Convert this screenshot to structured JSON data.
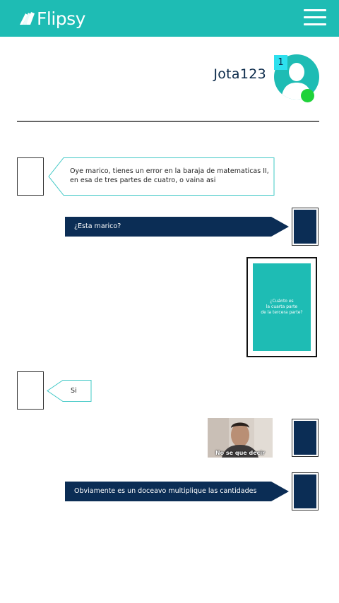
{
  "app": {
    "brand": "Flipsy",
    "colors": {
      "brand_teal": "#1ebcb4",
      "navy": "#0b2d55",
      "online_green": "#1fd23a",
      "badge_cyan": "#2ee0ee"
    },
    "menu_icon": "hamburger-menu-icon"
  },
  "profile": {
    "username": "Jota123",
    "badge_count": "1",
    "avatar_icon": "user-avatar-icon",
    "status": "online"
  },
  "messages": [
    {
      "from": "other",
      "type": "text",
      "text": "Oye marico, tienes un error en la baraja de matematicas II,\nen esa de tres partes de cuatro, o vaina asi"
    },
    {
      "from": "me",
      "type": "text",
      "text": "¿Esta marico?"
    },
    {
      "from": "me",
      "type": "card",
      "text": "¿Cuánto es\nla cuarta parte\nde la tercera parte?"
    },
    {
      "from": "other",
      "type": "text",
      "text": "Si"
    },
    {
      "from": "me",
      "type": "gif",
      "caption": "No se que decir"
    },
    {
      "from": "me",
      "type": "text",
      "text": "Obviamente es un doceavo multiplique las cantidades"
    }
  ]
}
